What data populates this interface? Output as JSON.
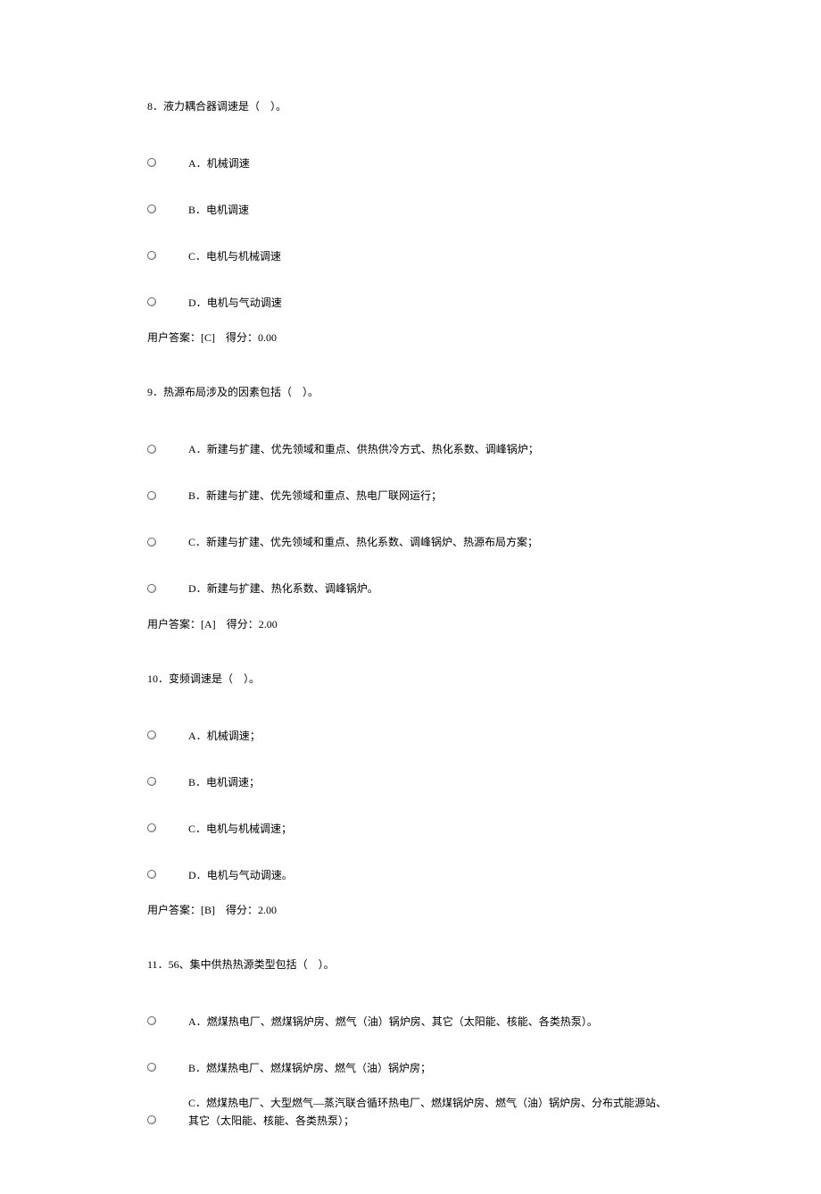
{
  "questions": [
    {
      "number": "8",
      "text": "液力耦合器调速是（　）。",
      "options": [
        {
          "letter": "A",
          "text": "机械调速"
        },
        {
          "letter": "B",
          "text": "电机调速"
        },
        {
          "letter": "C",
          "text": "电机与机械调速"
        },
        {
          "letter": "D",
          "text": "电机与气动调速"
        }
      ],
      "user_answer": "[C]",
      "score": "0.00"
    },
    {
      "number": "9",
      "text": "热源布局涉及的因素包括（　）。",
      "options": [
        {
          "letter": "A",
          "text": "新建与扩建、优先领域和重点、供热供冷方式、热化系数、调峰锅炉；"
        },
        {
          "letter": "B",
          "text": "新建与扩建、优先领域和重点、热电厂联网运行；"
        },
        {
          "letter": "C",
          "text": "新建与扩建、优先领域和重点、热化系数、调峰锅炉、热源布局方案；"
        },
        {
          "letter": "D",
          "text": "新建与扩建、热化系数、调峰锅炉。"
        }
      ],
      "user_answer": "[A]",
      "score": "2.00"
    },
    {
      "number": "10",
      "text": "变频调速是（　）。",
      "options": [
        {
          "letter": "A",
          "text": "机械调速；"
        },
        {
          "letter": "B",
          "text": "电机调速；"
        },
        {
          "letter": "C",
          "text": "电机与机械调速；"
        },
        {
          "letter": "D",
          "text": "电机与气动调速。"
        }
      ],
      "user_answer": "[B]",
      "score": "2.00"
    },
    {
      "number": "11",
      "text": "56、集中供热热源类型包括（　）。",
      "options": [
        {
          "letter": "A",
          "text": "燃煤热电厂、燃煤锅炉房、燃气（油）锅炉房、其它（太阳能、核能、各类热泵）。"
        },
        {
          "letter": "B",
          "text": "燃煤热电厂、燃煤锅炉房、燃气（油）锅炉房；"
        },
        {
          "letter": "C",
          "text": "燃煤热电厂、大型燃气—蒸汽联合循环热电厂、燃煤锅炉房、燃气（油）锅炉房、分布式能源站、其它（太阳能、核能、各类热泵）；"
        }
      ],
      "user_answer": null,
      "score": null
    }
  ],
  "labels": {
    "user_answer_prefix": "用户答案：",
    "score_prefix": "得分：",
    "separator": "．",
    "option_separator": "．"
  },
  "footer": ""
}
